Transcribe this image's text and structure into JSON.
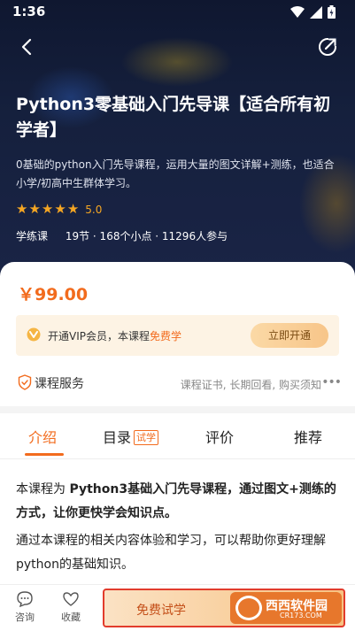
{
  "status": {
    "time": "1:36"
  },
  "course": {
    "title": "Python3零基础入门先导课【适合所有初学者】",
    "description": "0基础的python入门先导课程，运用大量的图文详解+测练，也适合小学/初高中生群体学习。",
    "rating": "5.0",
    "stars": 5,
    "type": "学练课",
    "stats": "19节 · 168个小点 · 11296人参与"
  },
  "price": "￥99.00",
  "vip": {
    "text": "开通VIP会员，本课程",
    "free": "免费学",
    "button": "立即开通"
  },
  "service": {
    "label": "课程服务",
    "desc": "课程证书, 长期回看, 购买须知",
    "more": "•••"
  },
  "tabs": {
    "intro": "介绍",
    "catalog": "目录",
    "catalog_badge": "试学",
    "review": "评价",
    "recommend": "推荐"
  },
  "intro": {
    "p1_prefix": "本课程为 ",
    "p1_bold": "Python3基础入门先导课程，通过图文+测练的方式，让你更快学会知识点。",
    "p2": "通过本课程的相关内容体验和学习，可以帮助你更好理解python的基础知识。"
  },
  "bottom": {
    "consult": "咨询",
    "favorite": "收藏",
    "trial": "免费试学"
  },
  "watermark": {
    "text": "西西软件园",
    "sub": "CR173.COM"
  },
  "colors": {
    "accent": "#f26b1d",
    "star": "#f5a623"
  }
}
